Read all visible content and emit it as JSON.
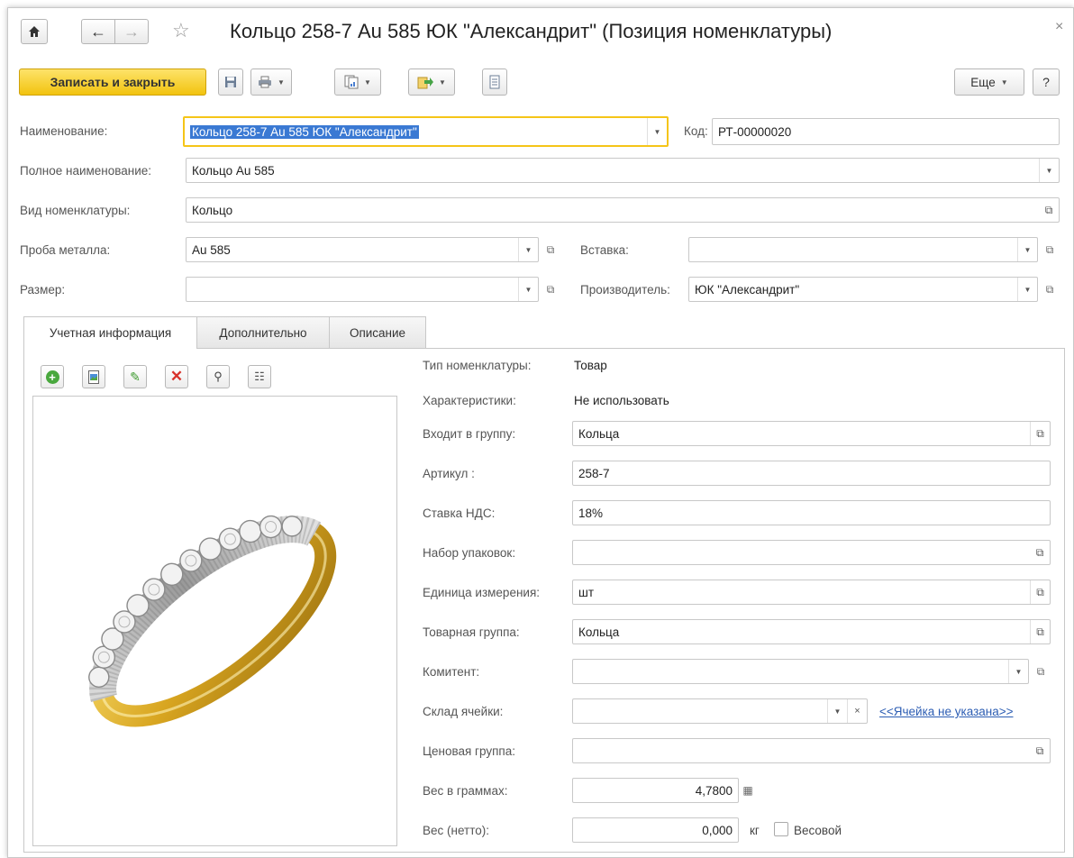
{
  "window": {
    "title": "Кольцо 258-7 Au 585 ЮК \"Александрит\" (Позиция номенклатуры)",
    "close": "×"
  },
  "toolbar": {
    "save_close": "Записать и закрыть",
    "more": "Еще",
    "help": "?"
  },
  "fields": {
    "name_label": "Наименование:",
    "name_value": "Кольцо 258-7 Au 585 ЮК \"Александрит\"",
    "code_label": "Код:",
    "code_value": "РТ-00000020",
    "full_name_label": "Полное наименование:",
    "full_name_value": "Кольцо Au 585",
    "kind_label": "Вид номенклатуры:",
    "kind_value": "Кольцо",
    "metal_label": "Проба металла:",
    "metal_value": "Au 585",
    "insert_label": "Вставка:",
    "insert_value": "",
    "size_label": "Размер:",
    "size_value": "",
    "maker_label": "Производитель:",
    "maker_value": "ЮК \"Александрит\""
  },
  "tabs": [
    {
      "label": "Учетная информация"
    },
    {
      "label": "Дополнительно"
    },
    {
      "label": "Описание"
    }
  ],
  "details": {
    "type_label": "Тип номенклатуры:",
    "type_value": "Товар",
    "chars_label": "Характеристики:",
    "chars_value": "Не использовать",
    "group_label": "Входит в группу:",
    "group_value": "Кольца",
    "article_label": "Артикул :",
    "article_value": "258-7",
    "vat_label": "Ставка НДС:",
    "vat_value": "18%",
    "pack_label": "Набор упаковок:",
    "pack_value": "",
    "unit_label": "Единица измерения:",
    "unit_value": "шт",
    "goods_group_label": "Товарная группа:",
    "goods_group_value": "Кольца",
    "committent_label": "Комитент:",
    "committent_value": "",
    "cell_label": "Склад ячейки:",
    "cell_value": "",
    "cell_link": "<<Ячейка не указана>>",
    "price_group_label": "Ценовая группа:",
    "price_group_value": "",
    "weight_label": "Вес в граммах:",
    "weight_value": "4,7800",
    "net_label": "Вес (нетто):",
    "net_value": "0,000",
    "net_unit": "кг",
    "weighted_label": "Весовой"
  },
  "colors": {
    "accent_yellow": "#f5c518",
    "link_blue": "#2c5db3",
    "gold": "#d8a520"
  }
}
